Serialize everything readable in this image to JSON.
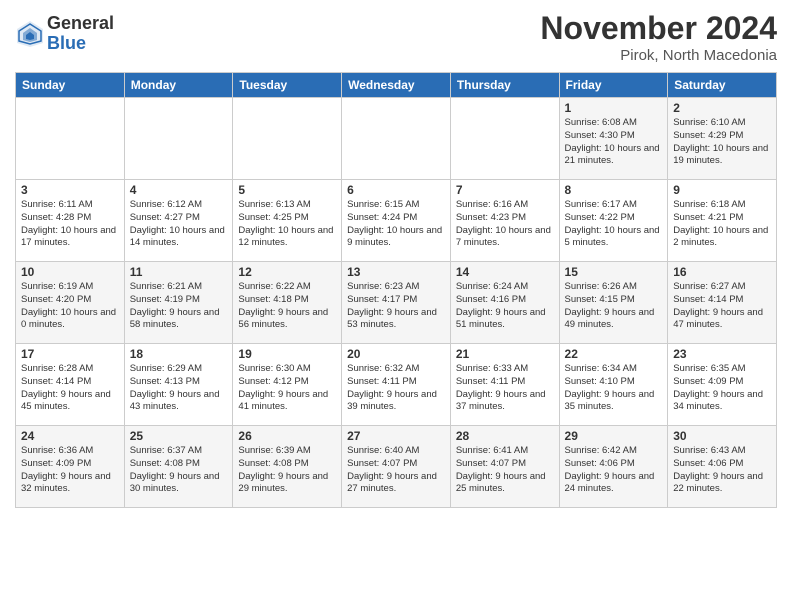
{
  "header": {
    "logo_general": "General",
    "logo_blue": "Blue",
    "month": "November 2024",
    "location": "Pirok, North Macedonia"
  },
  "weekdays": [
    "Sunday",
    "Monday",
    "Tuesday",
    "Wednesday",
    "Thursday",
    "Friday",
    "Saturday"
  ],
  "weeks": [
    [
      {
        "day": "",
        "info": ""
      },
      {
        "day": "",
        "info": ""
      },
      {
        "day": "",
        "info": ""
      },
      {
        "day": "",
        "info": ""
      },
      {
        "day": "",
        "info": ""
      },
      {
        "day": "1",
        "info": "Sunrise: 6:08 AM\nSunset: 4:30 PM\nDaylight: 10 hours and 21 minutes."
      },
      {
        "day": "2",
        "info": "Sunrise: 6:10 AM\nSunset: 4:29 PM\nDaylight: 10 hours and 19 minutes."
      }
    ],
    [
      {
        "day": "3",
        "info": "Sunrise: 6:11 AM\nSunset: 4:28 PM\nDaylight: 10 hours and 17 minutes."
      },
      {
        "day": "4",
        "info": "Sunrise: 6:12 AM\nSunset: 4:27 PM\nDaylight: 10 hours and 14 minutes."
      },
      {
        "day": "5",
        "info": "Sunrise: 6:13 AM\nSunset: 4:25 PM\nDaylight: 10 hours and 12 minutes."
      },
      {
        "day": "6",
        "info": "Sunrise: 6:15 AM\nSunset: 4:24 PM\nDaylight: 10 hours and 9 minutes."
      },
      {
        "day": "7",
        "info": "Sunrise: 6:16 AM\nSunset: 4:23 PM\nDaylight: 10 hours and 7 minutes."
      },
      {
        "day": "8",
        "info": "Sunrise: 6:17 AM\nSunset: 4:22 PM\nDaylight: 10 hours and 5 minutes."
      },
      {
        "day": "9",
        "info": "Sunrise: 6:18 AM\nSunset: 4:21 PM\nDaylight: 10 hours and 2 minutes."
      }
    ],
    [
      {
        "day": "10",
        "info": "Sunrise: 6:19 AM\nSunset: 4:20 PM\nDaylight: 10 hours and 0 minutes."
      },
      {
        "day": "11",
        "info": "Sunrise: 6:21 AM\nSunset: 4:19 PM\nDaylight: 9 hours and 58 minutes."
      },
      {
        "day": "12",
        "info": "Sunrise: 6:22 AM\nSunset: 4:18 PM\nDaylight: 9 hours and 56 minutes."
      },
      {
        "day": "13",
        "info": "Sunrise: 6:23 AM\nSunset: 4:17 PM\nDaylight: 9 hours and 53 minutes."
      },
      {
        "day": "14",
        "info": "Sunrise: 6:24 AM\nSunset: 4:16 PM\nDaylight: 9 hours and 51 minutes."
      },
      {
        "day": "15",
        "info": "Sunrise: 6:26 AM\nSunset: 4:15 PM\nDaylight: 9 hours and 49 minutes."
      },
      {
        "day": "16",
        "info": "Sunrise: 6:27 AM\nSunset: 4:14 PM\nDaylight: 9 hours and 47 minutes."
      }
    ],
    [
      {
        "day": "17",
        "info": "Sunrise: 6:28 AM\nSunset: 4:14 PM\nDaylight: 9 hours and 45 minutes."
      },
      {
        "day": "18",
        "info": "Sunrise: 6:29 AM\nSunset: 4:13 PM\nDaylight: 9 hours and 43 minutes."
      },
      {
        "day": "19",
        "info": "Sunrise: 6:30 AM\nSunset: 4:12 PM\nDaylight: 9 hours and 41 minutes."
      },
      {
        "day": "20",
        "info": "Sunrise: 6:32 AM\nSunset: 4:11 PM\nDaylight: 9 hours and 39 minutes."
      },
      {
        "day": "21",
        "info": "Sunrise: 6:33 AM\nSunset: 4:11 PM\nDaylight: 9 hours and 37 minutes."
      },
      {
        "day": "22",
        "info": "Sunrise: 6:34 AM\nSunset: 4:10 PM\nDaylight: 9 hours and 35 minutes."
      },
      {
        "day": "23",
        "info": "Sunrise: 6:35 AM\nSunset: 4:09 PM\nDaylight: 9 hours and 34 minutes."
      }
    ],
    [
      {
        "day": "24",
        "info": "Sunrise: 6:36 AM\nSunset: 4:09 PM\nDaylight: 9 hours and 32 minutes."
      },
      {
        "day": "25",
        "info": "Sunrise: 6:37 AM\nSunset: 4:08 PM\nDaylight: 9 hours and 30 minutes."
      },
      {
        "day": "26",
        "info": "Sunrise: 6:39 AM\nSunset: 4:08 PM\nDaylight: 9 hours and 29 minutes."
      },
      {
        "day": "27",
        "info": "Sunrise: 6:40 AM\nSunset: 4:07 PM\nDaylight: 9 hours and 27 minutes."
      },
      {
        "day": "28",
        "info": "Sunrise: 6:41 AM\nSunset: 4:07 PM\nDaylight: 9 hours and 25 minutes."
      },
      {
        "day": "29",
        "info": "Sunrise: 6:42 AM\nSunset: 4:06 PM\nDaylight: 9 hours and 24 minutes."
      },
      {
        "day": "30",
        "info": "Sunrise: 6:43 AM\nSunset: 4:06 PM\nDaylight: 9 hours and 22 minutes."
      }
    ]
  ]
}
